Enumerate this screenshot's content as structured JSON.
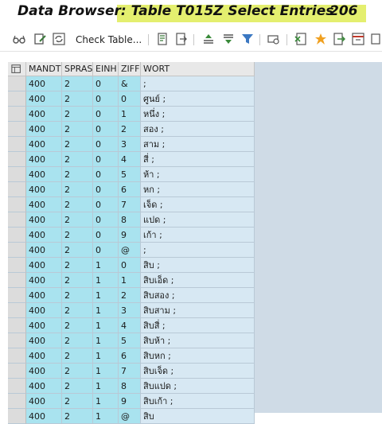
{
  "title": {
    "label": "Data Browser: ",
    "table": "Table T015Z Select Entries",
    "count": "206"
  },
  "toolbar": {
    "check_table_label": "Check Table..."
  },
  "table": {
    "headers": {
      "mandt": "MANDT",
      "spras": "SPRAS",
      "einh": "EINH",
      "ziff": "ZIFF",
      "wort": "WORT"
    },
    "rows": [
      [
        "400",
        "2",
        "0",
        "&",
        ";"
      ],
      [
        "400",
        "2",
        "0",
        "0",
        "ศูนย์ ;"
      ],
      [
        "400",
        "2",
        "0",
        "1",
        "หนึ่ง ;"
      ],
      [
        "400",
        "2",
        "0",
        "2",
        "สอง ;"
      ],
      [
        "400",
        "2",
        "0",
        "3",
        "สาม ;"
      ],
      [
        "400",
        "2",
        "0",
        "4",
        "สี่ ;"
      ],
      [
        "400",
        "2",
        "0",
        "5",
        "ห้า ;"
      ],
      [
        "400",
        "2",
        "0",
        "6",
        "หก ;"
      ],
      [
        "400",
        "2",
        "0",
        "7",
        "เจ็ด ;"
      ],
      [
        "400",
        "2",
        "0",
        "8",
        "แปด ;"
      ],
      [
        "400",
        "2",
        "0",
        "9",
        "เก้า ;"
      ],
      [
        "400",
        "2",
        "0",
        "@",
        ";"
      ],
      [
        "400",
        "2",
        "1",
        "0",
        "สิบ ;"
      ],
      [
        "400",
        "2",
        "1",
        "1",
        "สิบเอ็ด ;"
      ],
      [
        "400",
        "2",
        "1",
        "2",
        "สิบสอง ;"
      ],
      [
        "400",
        "2",
        "1",
        "3",
        "สิบสาม ;"
      ],
      [
        "400",
        "2",
        "1",
        "4",
        "สิบสี่ ;"
      ],
      [
        "400",
        "2",
        "1",
        "5",
        "สิบห้า ;"
      ],
      [
        "400",
        "2",
        "1",
        "6",
        "สิบหก ;"
      ],
      [
        "400",
        "2",
        "1",
        "7",
        "สิบเจ็ด ;"
      ],
      [
        "400",
        "2",
        "1",
        "8",
        "สิบแปด ;"
      ],
      [
        "400",
        "2",
        "1",
        "9",
        "สิบเก้า ;"
      ],
      [
        "400",
        "2",
        "1",
        "@",
        "สิบ"
      ]
    ]
  }
}
